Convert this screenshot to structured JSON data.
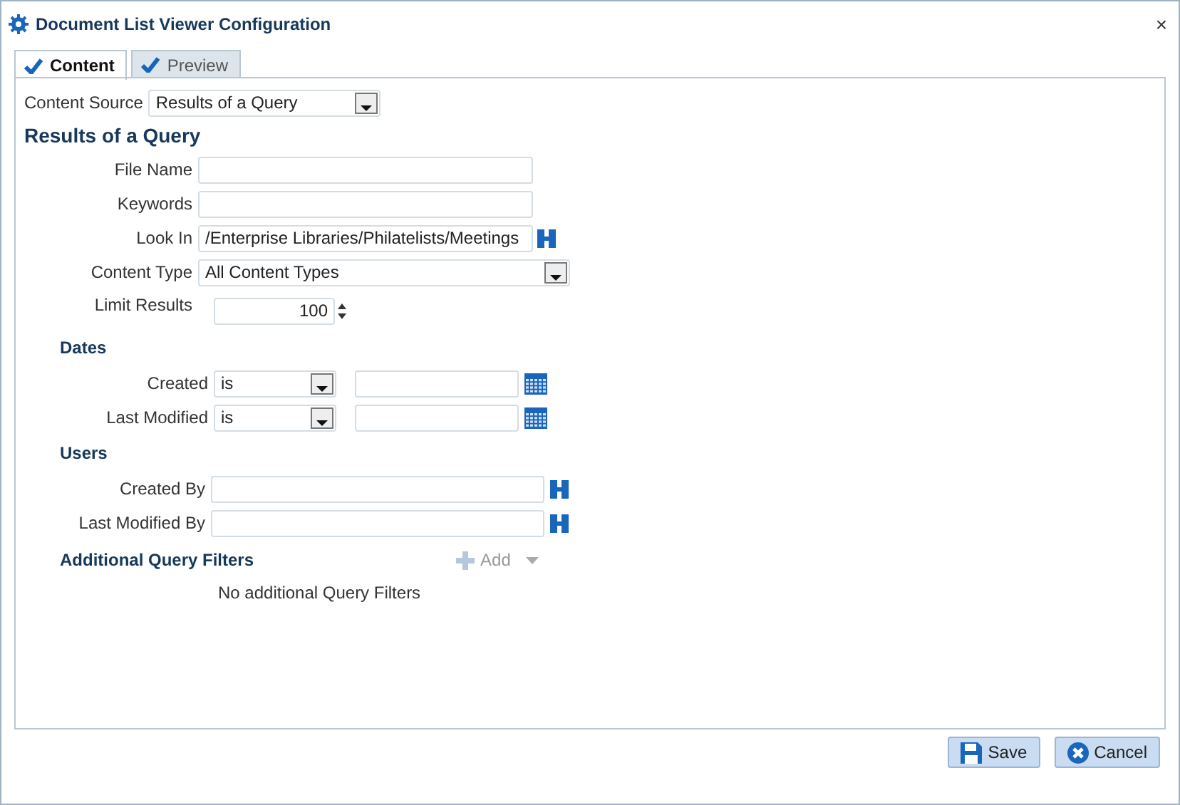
{
  "window": {
    "title": "Document List Viewer Configuration",
    "close": "×"
  },
  "tabs": [
    {
      "label": "Content",
      "selected": true
    },
    {
      "label": "Preview",
      "selected": false
    }
  ],
  "content_source": {
    "label": "Content Source",
    "value": "Results of a Query"
  },
  "section_title": "Results of a Query",
  "fields": [
    {
      "kind": "text",
      "label": "File Name"
    },
    {
      "kind": "text",
      "label": "Keywords"
    },
    {
      "kind": "lookup",
      "label": "Look In",
      "value": "/Enterprise Libraries/Philatelists/Meetings"
    },
    {
      "kind": "select",
      "label": "Content Type",
      "value": "All Content Types"
    },
    {
      "kind": "spinner",
      "label": "Limit Results",
      "value": "100"
    }
  ],
  "dates": {
    "heading": "Dates",
    "rows": [
      {
        "label": "Created",
        "operator": "is"
      },
      {
        "label": "Last Modified",
        "operator": "is"
      }
    ]
  },
  "users": {
    "heading": "Users",
    "rows": [
      {
        "label": "Created By"
      },
      {
        "label": "Last Modified By"
      }
    ]
  },
  "filters": {
    "heading": "Additional Query Filters",
    "add": "Add",
    "empty": "No additional Query Filters"
  },
  "buttons": [
    {
      "kind": "save",
      "label": "Save"
    },
    {
      "kind": "cancel",
      "label": "Cancel"
    }
  ]
}
